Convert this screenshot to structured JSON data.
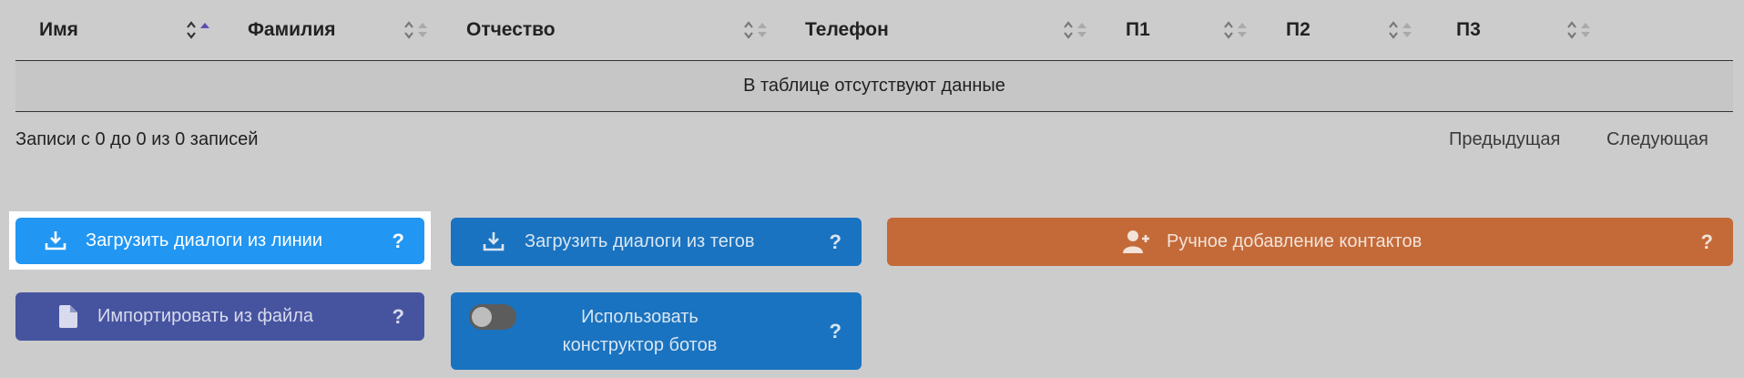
{
  "table": {
    "columns": [
      {
        "label": "Имя",
        "sorted": "asc"
      },
      {
        "label": "Фамилия"
      },
      {
        "label": "Отчество"
      },
      {
        "label": "Телефон"
      },
      {
        "label": "П1"
      },
      {
        "label": "П2"
      },
      {
        "label": "П3"
      }
    ],
    "empty_text": "В таблице отсутствуют данные"
  },
  "info": "Записи с 0 до 0 из 0 записей",
  "pagination": {
    "prev": "Предыдущая",
    "next": "Следующая"
  },
  "buttons": {
    "load_line": {
      "label": "Загрузить диалоги из линии",
      "help": "?"
    },
    "load_tags": {
      "label": "Загрузить диалоги из тегов",
      "help": "?"
    },
    "manual_add": {
      "label": "Ручное добавление контактов",
      "help": "?"
    },
    "import_file": {
      "label": "Импортировать из файла",
      "help": "?"
    },
    "bot_builder": {
      "label": "Использовать конструктор ботов",
      "help": "?",
      "enabled": false
    }
  },
  "icons": {
    "sort": "sort-icon",
    "download": "download-icon",
    "add_user": "add-user-icon",
    "file": "file-icon",
    "toggle": "toggle-switch"
  },
  "colors": {
    "background": "#cccccc",
    "primary_blue": "#2196f3",
    "dark_blue": "#1a73c0",
    "orange": "#c46a38",
    "indigo": "#4654a0"
  }
}
